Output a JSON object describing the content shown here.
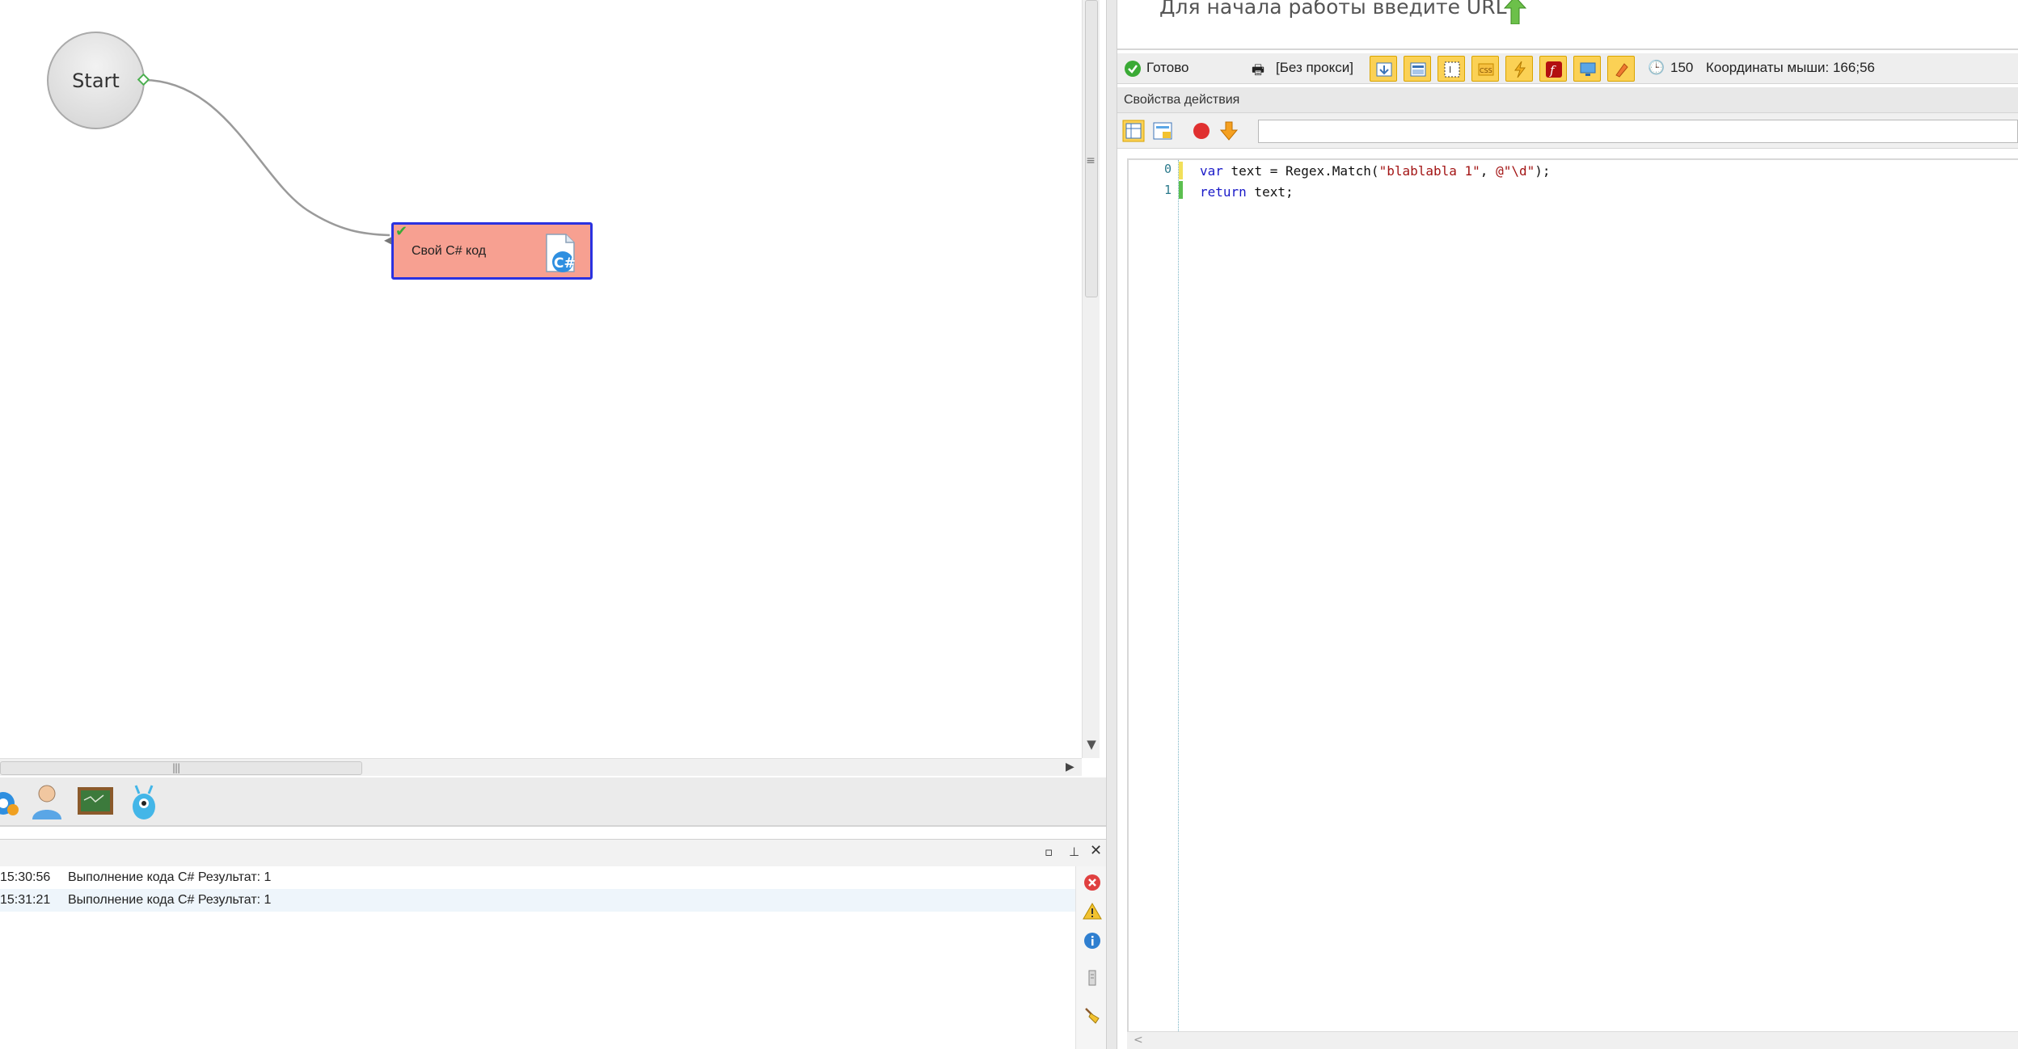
{
  "canvas": {
    "start_label": "Start",
    "action_label": "Свой C# код",
    "action_icon_text": "C#",
    "hscroll_grip": "|||",
    "vscroll_grip": "≡"
  },
  "tools": [
    {
      "icon": "gear-icon"
    },
    {
      "icon": "user-icon"
    },
    {
      "icon": "chalkboard-icon"
    },
    {
      "icon": "alien-icon"
    }
  ],
  "log": {
    "rows": [
      {
        "time": "15:30:56",
        "message": "Выполнение кода C#  Результат: 1"
      },
      {
        "time": "15:31:21",
        "message": "Выполнение кода C#  Результат: 1"
      }
    ]
  },
  "browser": {
    "url_hint": "Для начала работы введите URL"
  },
  "status": {
    "ready": "Готово",
    "proxy": "[Без прокси]",
    "timer": "150",
    "mouse": "Координаты мыши: 166;56"
  },
  "props": {
    "title": "Свойства действия"
  },
  "editor": {
    "lines": [
      {
        "n": "0",
        "kw": "var",
        "rest1": " text = Regex.Match(",
        "s1": "\"blablabla 1\"",
        "mid": ", ",
        "s2": "@\"\\d\"",
        "end": ");"
      },
      {
        "n": "1",
        "kw": "return",
        "rest1": " text;"
      }
    ]
  },
  "colors": {
    "action_fill": "#f7a091",
    "action_border": "#2a32e0",
    "accent_yellow": "#fbd155",
    "ok_green": "#3aaa35"
  }
}
